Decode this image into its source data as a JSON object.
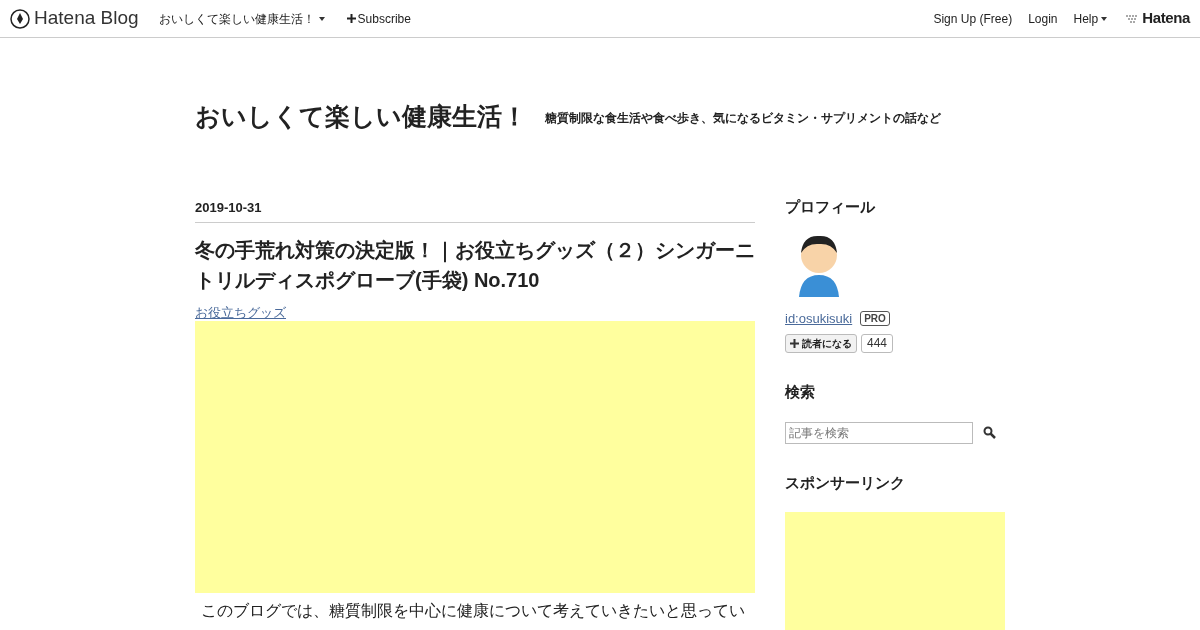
{
  "navbar": {
    "logo": "Hatena Blog",
    "blog_menu": "おいしくて楽しい健康生活！",
    "subscribe": "Subscribe",
    "links": [
      {
        "label": "Sign Up (Free)",
        "kind": "link"
      },
      {
        "label": "Login",
        "kind": "link"
      },
      {
        "label": "Help",
        "kind": "menu"
      }
    ],
    "brand": "Hatena"
  },
  "blog": {
    "title": "おいしくて楽しい健康生活！",
    "description": "糖質制限な食生活や食べ歩き、気になるビタミン・サプリメントの話など"
  },
  "entry": {
    "date": "2019-10-31",
    "title": "冬の手荒れ対策の決定版！｜お役立ちグッズ（２）シンガーニトリルディスポグローブ(手袋) No.710",
    "category": "お役立ちグッズ",
    "body": "このブログでは、糖質制限を中心に健康について考えていきたいと思ってい"
  },
  "sidebar": {
    "profile": {
      "heading": "プロフィール",
      "user_id": "id:osukisuki",
      "badge": "PRO",
      "follow_button": "読者になる",
      "follower_count": "444"
    },
    "search": {
      "heading": "検索",
      "placeholder": "記事を検索"
    },
    "sponsor": {
      "heading": "スポンサーリンク"
    }
  }
}
